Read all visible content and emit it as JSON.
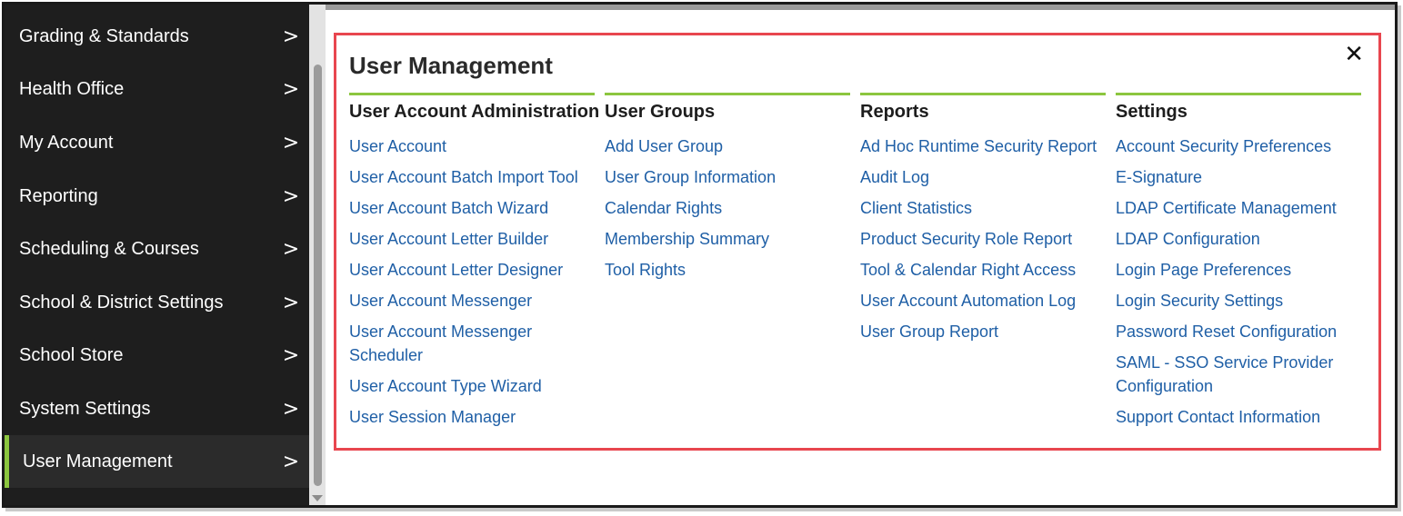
{
  "sidebar": {
    "items": [
      {
        "label": "Grading & Standards"
      },
      {
        "label": "Health Office"
      },
      {
        "label": "My Account"
      },
      {
        "label": "Reporting"
      },
      {
        "label": "Scheduling & Courses"
      },
      {
        "label": "School & District Settings"
      },
      {
        "label": "School Store"
      },
      {
        "label": "System Settings"
      },
      {
        "label": "User Management"
      }
    ],
    "active_index": 8,
    "chevron": ">"
  },
  "panel": {
    "title": "User Management",
    "close_glyph": "✕",
    "columns": [
      {
        "heading": "User Account Administration",
        "links": [
          "User Account",
          "User Account Batch Import Tool",
          "User Account Batch Wizard",
          "User Account Letter Builder",
          "User Account Letter Designer",
          "User Account Messenger",
          "User Account Messenger Scheduler",
          "User Account Type Wizard",
          "User Session Manager"
        ]
      },
      {
        "heading": "User Groups",
        "links": [
          "Add User Group",
          "User Group Information",
          "Calendar Rights",
          "Membership Summary",
          "Tool Rights"
        ]
      },
      {
        "heading": "Reports",
        "links": [
          "Ad Hoc Runtime Security Report",
          "Audit Log",
          "Client Statistics",
          "Product Security Role Report",
          "Tool & Calendar Right Access",
          "User Account Automation Log",
          "User Group Report"
        ]
      },
      {
        "heading": "Settings",
        "links": [
          "Account Security Preferences",
          "E-Signature",
          "LDAP Certificate Management",
          "LDAP Configuration",
          "Login Page Preferences",
          "Login Security Settings",
          "Password Reset Configuration",
          "SAML - SSO Service Provider Configuration",
          "Support Contact Information"
        ]
      }
    ]
  },
  "colors": {
    "sidebar_bg": "#1e1e1e",
    "accent_green": "#8cc63f",
    "link_blue": "#1f5fa6",
    "highlight_red": "#e8464f"
  }
}
